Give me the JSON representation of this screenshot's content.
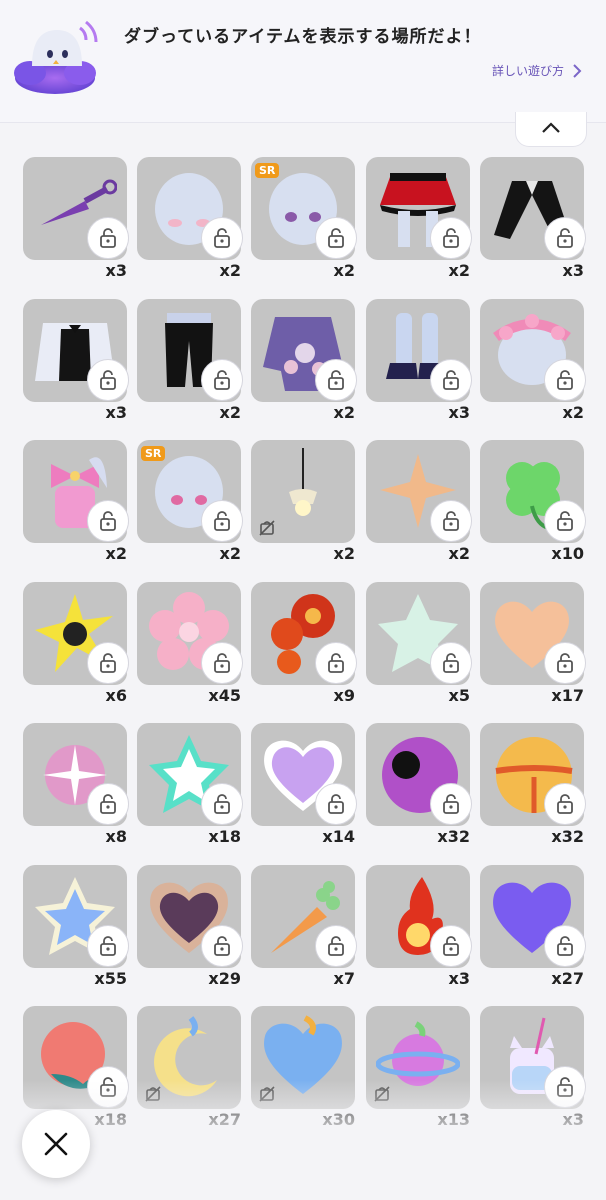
{
  "header": {
    "message": "ダブっているアイテムを表示する場所だよ！",
    "howto_label": "詳しい遊び方",
    "mascot_icon": "ghost-mascot-icon"
  },
  "controls": {
    "collapse_icon": "chevron-up-icon",
    "close_icon": "close-icon"
  },
  "colors": {
    "tile": "#c4c4c4",
    "sr_badge": "#f09a1a",
    "accent": "#6a56b8"
  },
  "items": [
    {
      "name": "kunai",
      "count": "x3",
      "icon": "lock"
    },
    {
      "name": "head-blush",
      "count": "x2",
      "icon": "lock"
    },
    {
      "name": "head-eyes",
      "count": "x2",
      "icon": "lock",
      "badge": "SR"
    },
    {
      "name": "red-skirt",
      "count": "x2",
      "icon": "lock"
    },
    {
      "name": "black-jacket",
      "count": "x3",
      "icon": "lock"
    },
    {
      "name": "butler-vest",
      "count": "x3",
      "icon": "lock"
    },
    {
      "name": "black-pants",
      "count": "x2",
      "icon": "lock"
    },
    {
      "name": "floral-kimono",
      "count": "x2",
      "icon": "lock"
    },
    {
      "name": "shoes-socks",
      "count": "x3",
      "icon": "lock"
    },
    {
      "name": "flower-crown",
      "count": "x2",
      "icon": "lock"
    },
    {
      "name": "pink-bow",
      "count": "x2",
      "icon": "lock"
    },
    {
      "name": "head-pink-eyes",
      "count": "x2",
      "icon": "lock",
      "badge": "SR"
    },
    {
      "name": "pendant-lamp",
      "count": "x2",
      "icon": "untradable"
    },
    {
      "name": "orange-sparkle",
      "count": "x2",
      "icon": "lock"
    },
    {
      "name": "green-clover",
      "count": "x10",
      "icon": "lock"
    },
    {
      "name": "yellow-splat",
      "count": "x6",
      "icon": "lock"
    },
    {
      "name": "pink-flower",
      "count": "x45",
      "icon": "lock"
    },
    {
      "name": "red-roses",
      "count": "x9",
      "icon": "lock"
    },
    {
      "name": "pastel-star",
      "count": "x5",
      "icon": "lock"
    },
    {
      "name": "rainbow-heart",
      "count": "x17",
      "icon": "lock"
    },
    {
      "name": "pink-glow",
      "count": "x8",
      "icon": "lock"
    },
    {
      "name": "teal-star",
      "count": "x18",
      "icon": "lock"
    },
    {
      "name": "pixel-heart",
      "count": "x14",
      "icon": "lock"
    },
    {
      "name": "purple-eyeball",
      "count": "x32",
      "icon": "lock"
    },
    {
      "name": "golden-bell",
      "count": "x32",
      "icon": "lock"
    },
    {
      "name": "holo-star",
      "count": "x55",
      "icon": "lock"
    },
    {
      "name": "chocolate-heart",
      "count": "x29",
      "icon": "lock"
    },
    {
      "name": "carrot",
      "count": "x7",
      "icon": "lock"
    },
    {
      "name": "fireball",
      "count": "x3",
      "icon": "lock"
    },
    {
      "name": "blue-heart",
      "count": "x27",
      "icon": "lock"
    },
    {
      "name": "peach",
      "count": "x18",
      "icon": "lock"
    },
    {
      "name": "crescent-moon",
      "count": "x27",
      "icon": "untradable"
    },
    {
      "name": "planet-heart",
      "count": "x30",
      "icon": "untradable"
    },
    {
      "name": "ringed-planet",
      "count": "x13",
      "icon": "untradable"
    },
    {
      "name": "cat-jar-drink",
      "count": "x3",
      "icon": "lock"
    }
  ]
}
